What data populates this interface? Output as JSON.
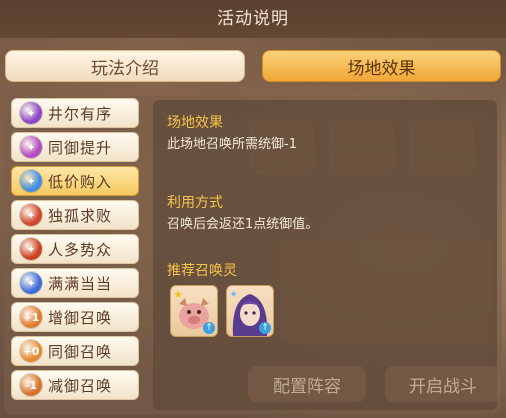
{
  "title": "活动说明",
  "tabs": [
    {
      "label": "玩法介绍",
      "active": false
    },
    {
      "label": "场地效果",
      "active": true
    }
  ],
  "sidebar": {
    "items": [
      {
        "label": "井尔有序",
        "icon": "purple-spiral-icon",
        "color": "#8d47c8"
      },
      {
        "label": "同御提升",
        "icon": "purple-gem-icon",
        "color": "#b44bc0"
      },
      {
        "label": "低价购入",
        "icon": "blue-crystal-icon",
        "color": "#3f8fe6",
        "selected": true
      },
      {
        "label": "独孤求败",
        "icon": "red-flame-icon",
        "color": "#d0452c"
      },
      {
        "label": "人多势众",
        "icon": "red-crowd-icon",
        "color": "#cc4020"
      },
      {
        "label": "满满当当",
        "icon": "blue-orb-icon",
        "color": "#3a6fd8"
      },
      {
        "label": "增御召唤",
        "icon": "plus-one-icon",
        "color": "#e27b2c",
        "glyph": "+1"
      },
      {
        "label": "同御召唤",
        "icon": "plus-zero-icon",
        "color": "#e68a32",
        "glyph": "+0"
      },
      {
        "label": "减御召唤",
        "icon": "minus-one-icon",
        "color": "#d97028",
        "glyph": "-1"
      }
    ]
  },
  "detail": {
    "effect_title": "场地效果",
    "effect_body": "此场地召唤所需统御-1",
    "usage_title": "利用方式",
    "usage_body": "召唤后会返还1点统御值。",
    "recommend_title": "推荐召唤灵"
  },
  "bottom": {
    "left_label": "配置阵容",
    "right_label": "开启战斗"
  },
  "colors": {
    "accent_gold": "#f6c44a",
    "tab_active": "#f1a637"
  }
}
